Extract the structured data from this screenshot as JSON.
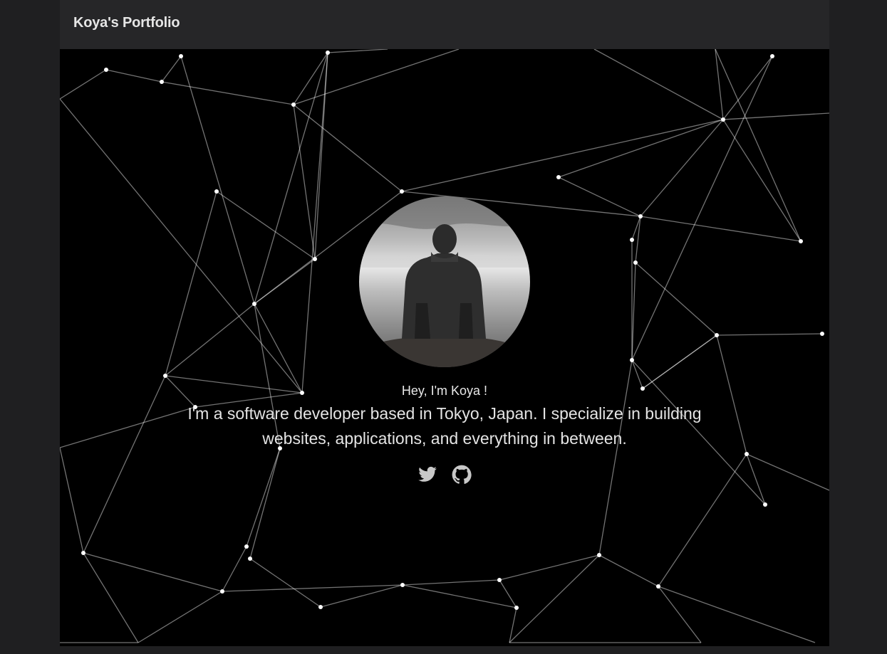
{
  "header": {
    "brand": "Koya's Portfolio"
  },
  "hero": {
    "avatar_alt": "Person sitting and looking at the clouds",
    "greeting": "Hey, I'm Koya !",
    "tagline": "I'm a software developer based in Tokyo, Japan. I specialize in building websites, applications, and everything in between.",
    "social_links": [
      {
        "name": "twitter",
        "icon": "twitter-icon"
      },
      {
        "name": "github",
        "icon": "github-icon"
      }
    ]
  },
  "colors": {
    "page_background": "#1f1f21",
    "navbar": "#262628",
    "hero_background": "#000000",
    "text": "#e4e4e4"
  }
}
